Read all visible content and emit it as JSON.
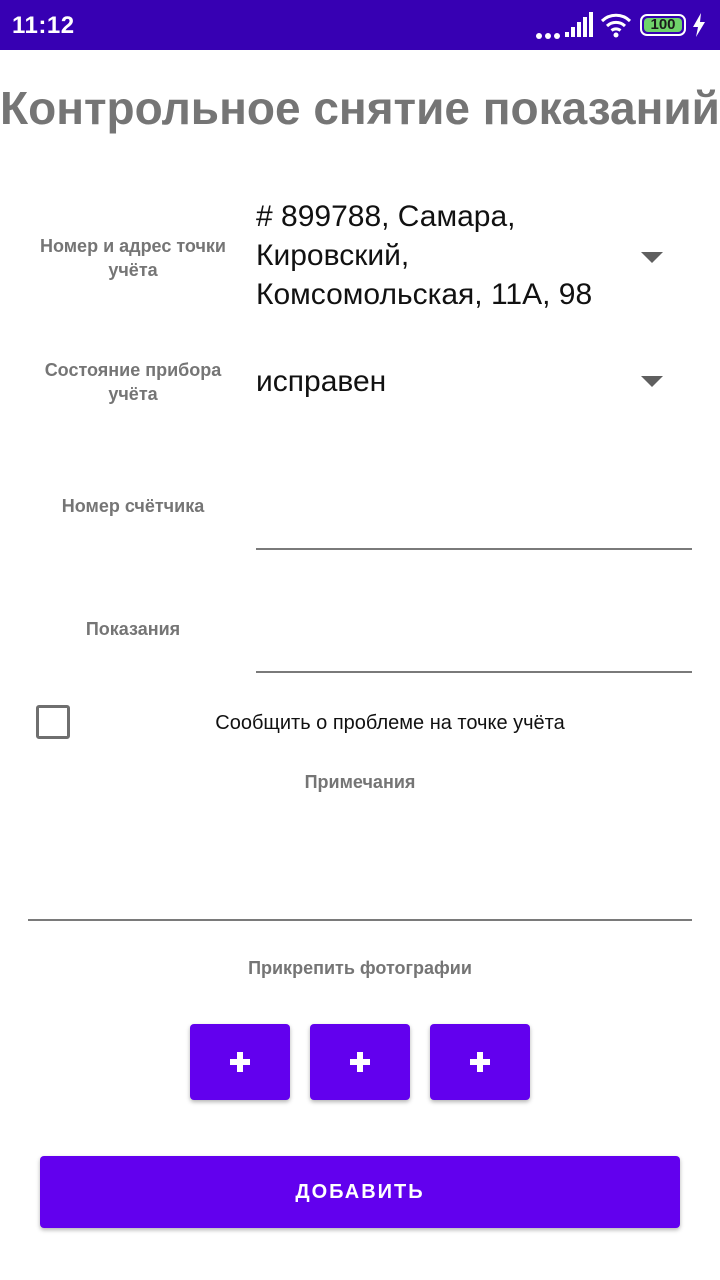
{
  "status_bar": {
    "time": "11:12",
    "battery": "100",
    "icons": [
      "more-dots-icon",
      "signal-icon",
      "wifi-icon",
      "battery-icon",
      "charging-icon"
    ]
  },
  "title": "Контрольное снятие показаний",
  "fields": {
    "point_label": "Номер и адрес точки учёта",
    "point_value": "# 899788, Самара, Кировский, Комсомольская, 11А, 98",
    "state_label": "Состояние прибора учёта",
    "state_value": "исправен",
    "meter_number_label": "Номер счётчика",
    "meter_number_value": "",
    "readings_label": "Показания",
    "readings_value": ""
  },
  "problem_checkbox": {
    "label": "Сообщить о проблеме на точке учёта",
    "checked": false
  },
  "notes": {
    "label": "Примечания",
    "value": ""
  },
  "photos": {
    "label": "Прикрепить фотографии",
    "buttons": [
      "add-photo-1",
      "add-photo-2",
      "add-photo-3"
    ]
  },
  "submit_label": "ДОБАВИТЬ",
  "colors": {
    "status_bar": "#3700b3",
    "accent": "#6200ee",
    "label_gray": "#757575"
  }
}
